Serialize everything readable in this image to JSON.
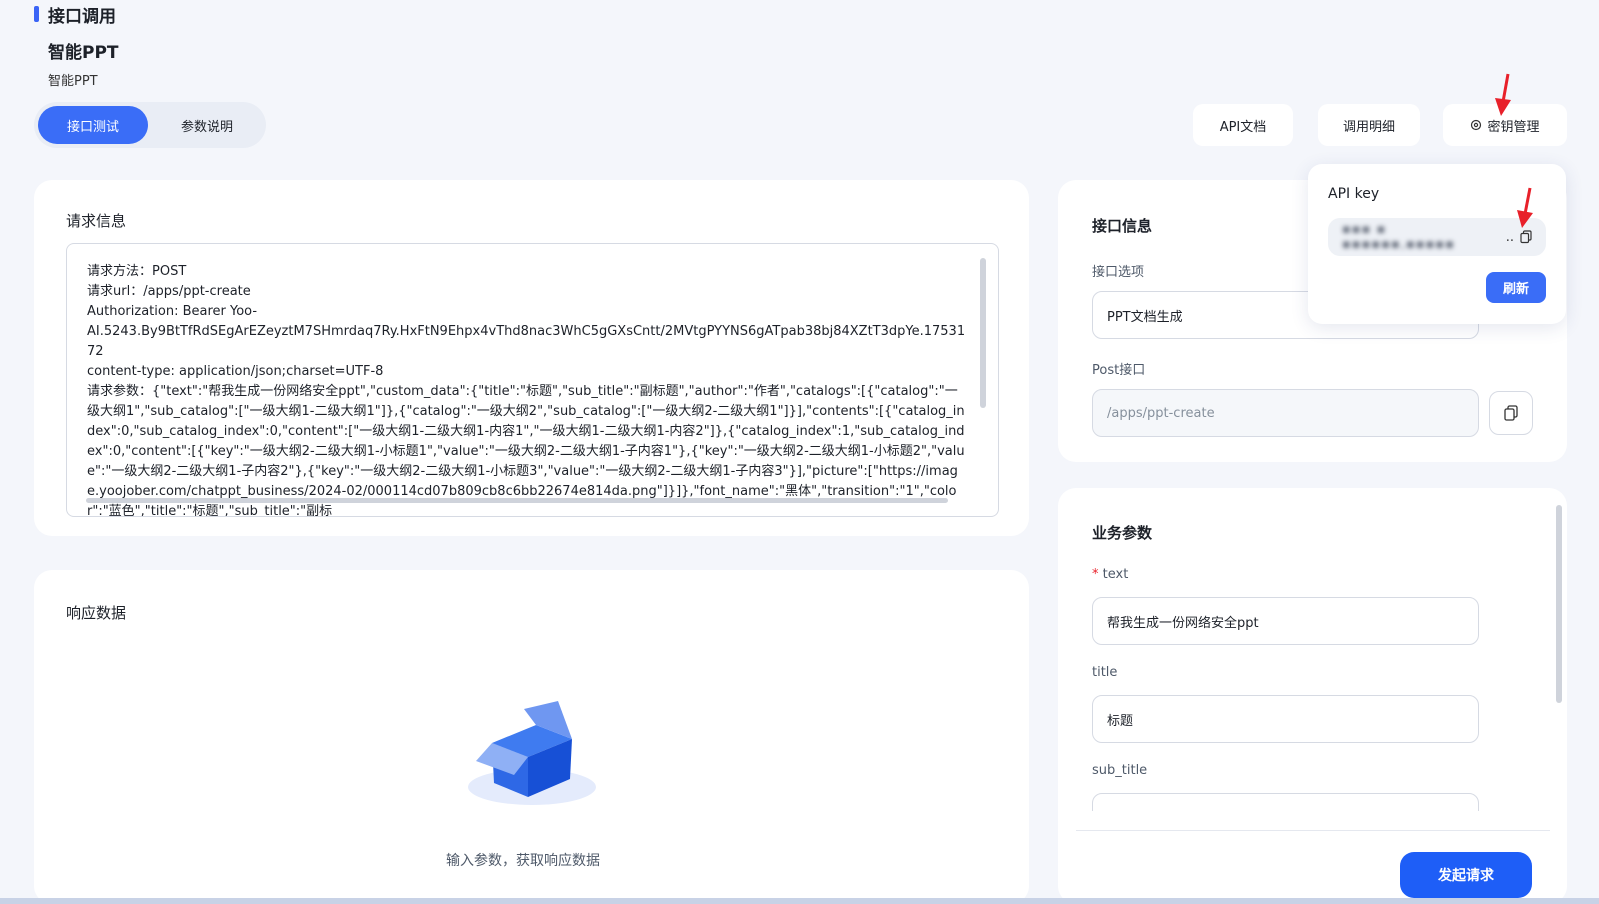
{
  "header": {
    "title": "接口调用",
    "api_name": "智能PPT",
    "api_desc": "智能PPT"
  },
  "tabs": [
    {
      "label": "接口测试",
      "active": true
    },
    {
      "label": "参数说明",
      "active": false
    }
  ],
  "top_buttons": {
    "api_doc": "API文档",
    "call_detail": "调用明细",
    "key_manage": "密钥管理"
  },
  "request": {
    "title": "请求信息",
    "text": "请求方法：POST\n请求url：/apps/ppt-create\nAuthorization: Bearer Yoo-\nAI.5243.By9BtTfRdSEgArEZeyztM7SHmrdaq7Ry.HxFtN9Ehpx4vThd8nac3WhC5gGXsCntt/2MVtgPYYNS6gATpab38bj84XZtT3dpYe.1753172\ncontent-type: application/json;charset=UTF-8\n请求参数：{\"text\":\"帮我生成一份网络安全ppt\",\"custom_data\":{\"title\":\"标题\",\"sub_title\":\"副标题\",\"author\":\"作者\",\"catalogs\":[{\"catalog\":\"一级大纲1\",\"sub_catalog\":[\"一级大纲1-二级大纲1\"]},{\"catalog\":\"一级大纲2\",\"sub_catalog\":[\"一级大纲2-二级大纲1\"]}],\"contents\":[{\"catalog_index\":0,\"sub_catalog_index\":0,\"content\":[\"一级大纲1-二级大纲1-内容1\",\"一级大纲1-二级大纲1-内容2\"]},{\"catalog_index\":1,\"sub_catalog_index\":0,\"content\":[{\"key\":\"一级大纲2-二级大纲1-小标题1\",\"value\":\"一级大纲2-二级大纲1-子内容1\"},{\"key\":\"一级大纲2-二级大纲1-小标题2\",\"value\":\"一级大纲2-二级大纲1-子内容2\"},{\"key\":\"一级大纲2-二级大纲1-小标题3\",\"value\":\"一级大纲2-二级大纲1-子内容3\"}],\"picture\":[\"https://image.yoojober.com/chatppt_business/2024-02/000114cd07b809cb8c6bb22674e814da.png\"]}]},\"font_name\":\"黑体\",\"transition\":\"1\",\"color\":\"蓝色\",\"title\":\"标题\",\"sub_title\":\"副标"
  },
  "response": {
    "title": "响应数据",
    "empty_text": "输入参数，获取响应数据"
  },
  "interface_info": {
    "title": "接口信息",
    "option_label": "接口选项",
    "option_value": "PPT文档生成",
    "post_label": "Post接口",
    "post_value": "/apps/ppt-create"
  },
  "biz_params": {
    "title": "业务参数",
    "required_mark": "*",
    "text_label": "text",
    "text_value": "帮我生成一份网络安全ppt",
    "title_label": "title",
    "title_value": "标题",
    "sub_title_label": "sub_title",
    "sub_title_value": ""
  },
  "submit_label": "发起请求",
  "api_key_popover": {
    "label": "API key",
    "masked_value": "▪▪▪ ▪ ▪▪▪▪▪▪,▪▪▪▪▪",
    "ellipsis": "..",
    "refresh_label": "刷新"
  },
  "colors": {
    "primary": "#3a6df7",
    "submit": "#1e5ef7",
    "annotation_arrow": "#e8202a"
  }
}
